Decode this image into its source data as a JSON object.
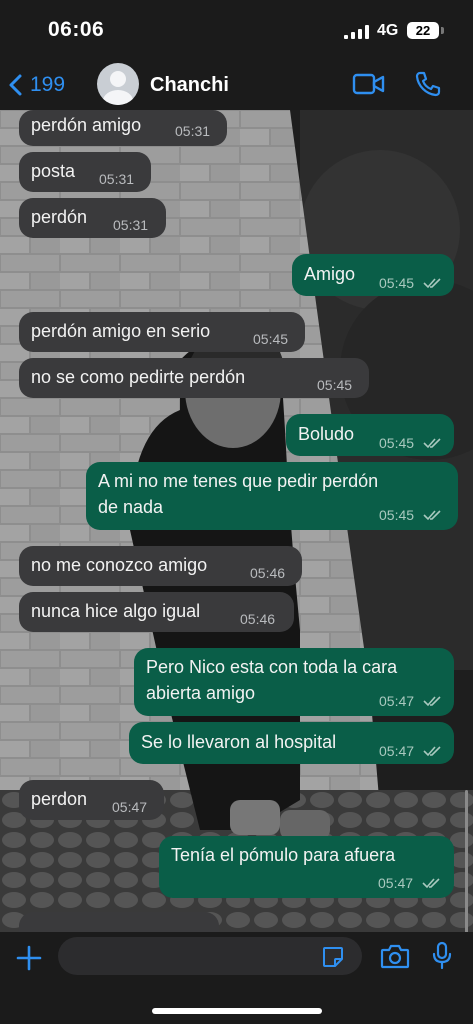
{
  "status_bar": {
    "time": "06:06",
    "network": "4G",
    "battery": "22"
  },
  "header": {
    "back_count": "199",
    "contact_name": "Chanchi"
  },
  "messages": [
    {
      "dir": "in",
      "text": "perdón amigo",
      "time": "05:31"
    },
    {
      "dir": "in",
      "text": "posta",
      "time": "05:31"
    },
    {
      "dir": "in",
      "text": "perdón",
      "time": "05:31"
    },
    {
      "dir": "out",
      "text": "Amigo",
      "time": "05:45",
      "read": true
    },
    {
      "dir": "in",
      "text": "perdón amigo en serio",
      "time": "05:45"
    },
    {
      "dir": "in",
      "text": "no se como pedirte perdón",
      "time": "05:45"
    },
    {
      "dir": "out",
      "text": "Boludo",
      "time": "05:45",
      "read": true
    },
    {
      "dir": "out",
      "text": "A mi no me tenes que pedir perdón de nada",
      "line1": "A mi no me tenes que pedir perdón",
      "line2": "de nada",
      "time": "05:45",
      "read": true
    },
    {
      "dir": "in",
      "text": "no me conozco amigo",
      "time": "05:46"
    },
    {
      "dir": "in",
      "text": "nunca hice algo igual",
      "time": "05:46"
    },
    {
      "dir": "out",
      "text": "Pero Nico esta con toda la cara abierta amigo",
      "line1": "Pero Nico esta con toda la cara",
      "line2": "abierta amigo",
      "time": "05:47",
      "read": true
    },
    {
      "dir": "out",
      "text": "Se lo llevaron al hospital",
      "time": "05:47",
      "read": true
    },
    {
      "dir": "in",
      "text": "perdon",
      "time": "05:47"
    },
    {
      "dir": "out",
      "text": "Tenía el pómulo para afuera",
      "time": "05:47",
      "read": true
    }
  ],
  "input": {
    "placeholder": "",
    "value": ""
  },
  "colors": {
    "accent": "#2f8ff0",
    "incoming_bubble": "#3a3a3c",
    "outgoing_bubble": "#0a5e48",
    "bar": "#1b1b1b"
  }
}
